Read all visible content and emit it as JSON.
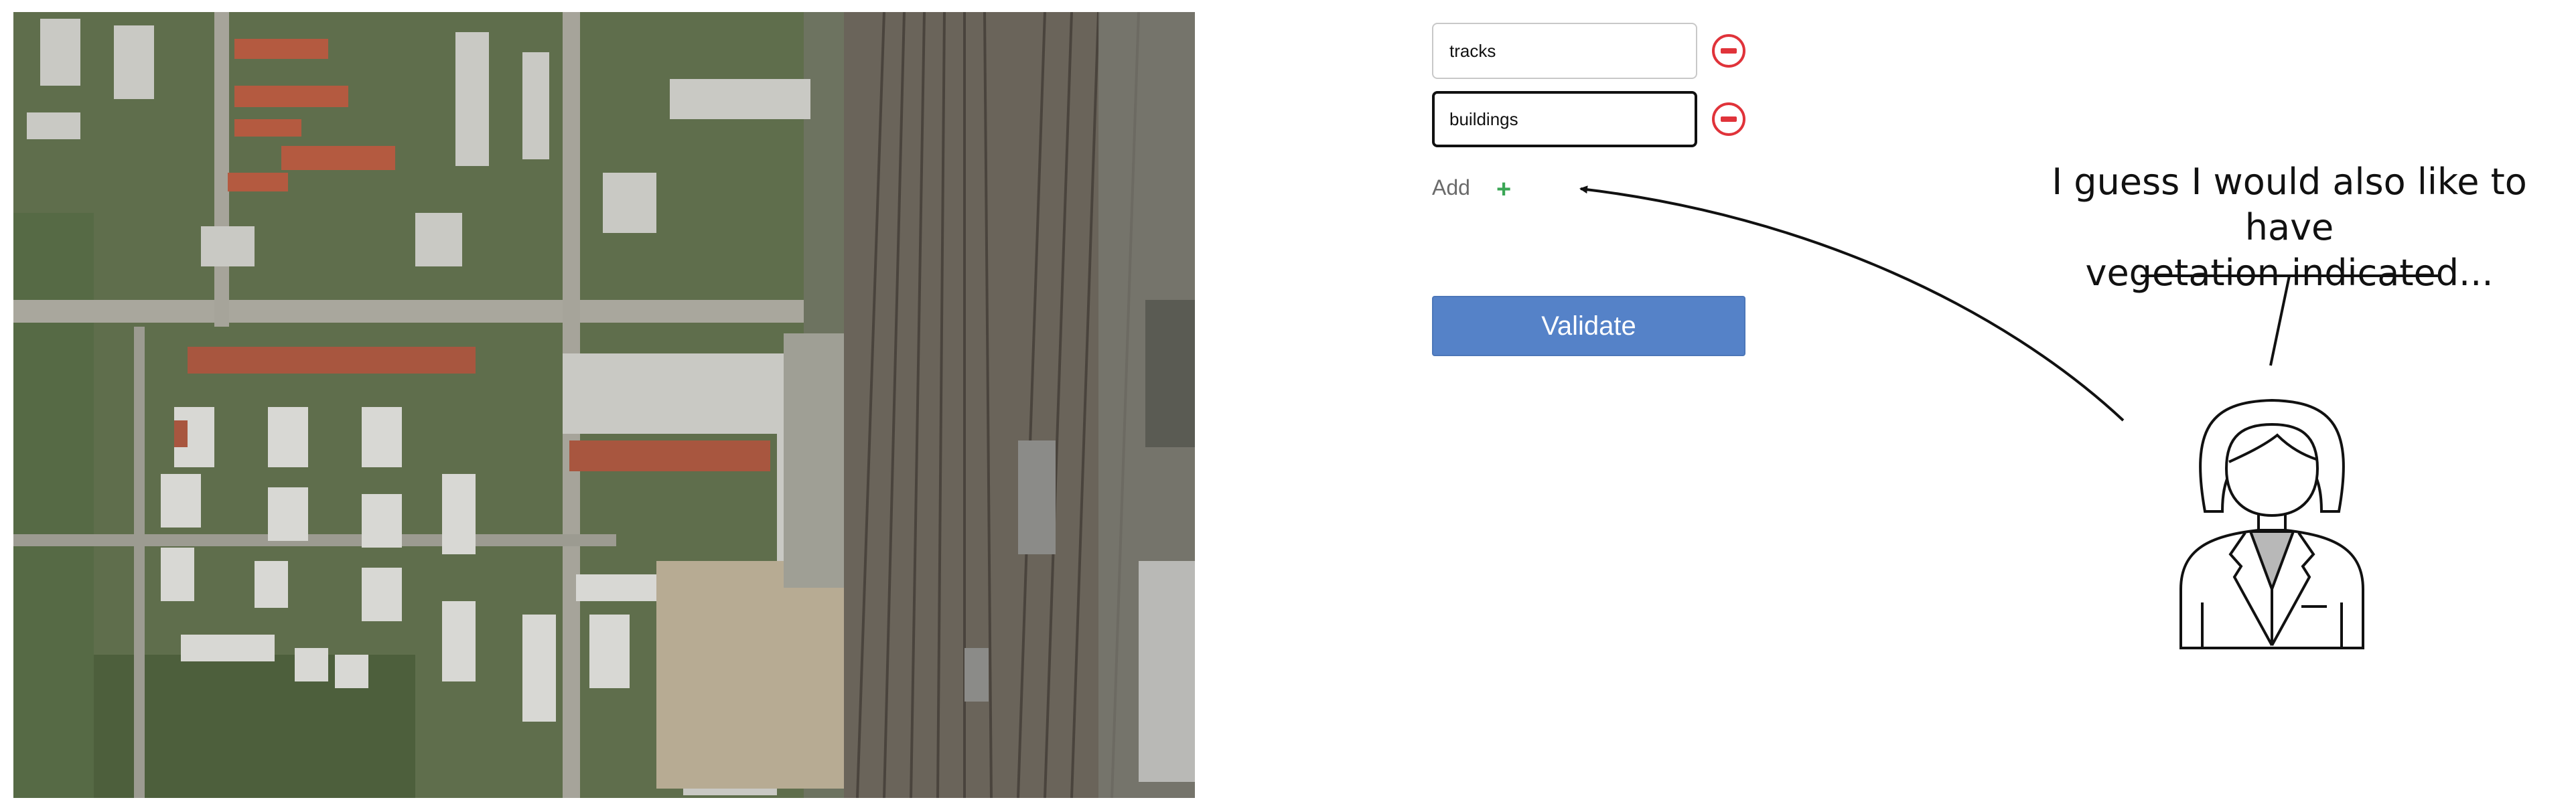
{
  "image": {
    "description_icon": "aerial-photo-icon"
  },
  "labels": [
    {
      "value": "tracks"
    },
    {
      "value": "buildings"
    }
  ],
  "form": {
    "add_label": "Add",
    "add_icon": "plus-icon",
    "remove_icon": "minus-circle-icon",
    "validate_label": "Validate"
  },
  "annotation": {
    "speech_line1": "I guess I would also like to have",
    "speech_line2": "vegetation indicated...",
    "person_icon": "person-icon"
  },
  "colors": {
    "remove": "#e0333a",
    "add": "#3aa655",
    "validate": "#5582c8"
  }
}
